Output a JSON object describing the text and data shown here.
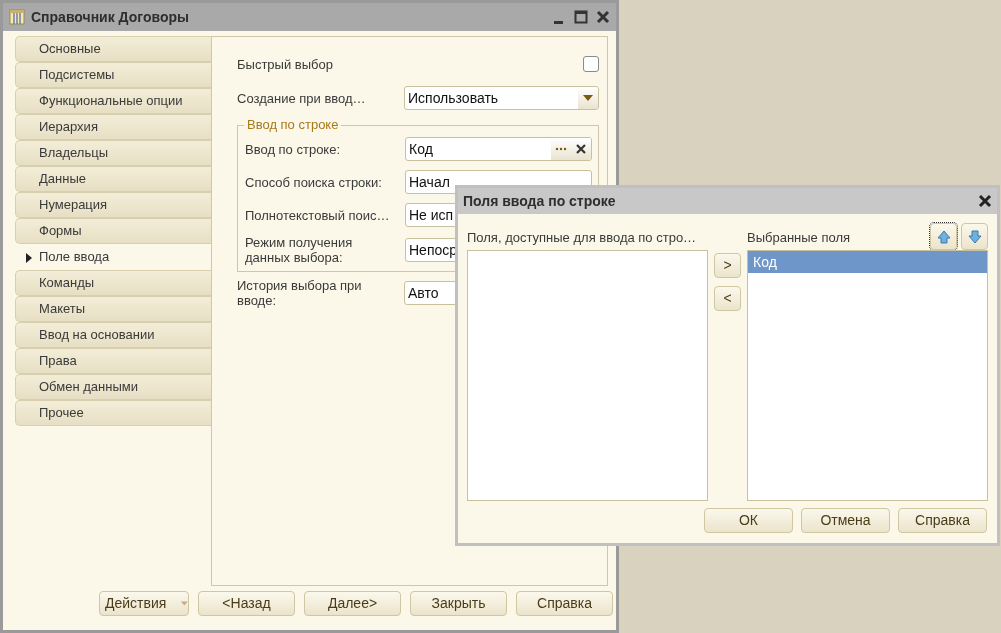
{
  "window": {
    "title": "Справочник Договоры"
  },
  "sections": [
    {
      "label": "Основные",
      "selected": false
    },
    {
      "label": "Подсистемы",
      "selected": false
    },
    {
      "label": "Функциональные опции",
      "selected": false
    },
    {
      "label": "Иерархия",
      "selected": false
    },
    {
      "label": "Владельцы",
      "selected": false
    },
    {
      "label": "Данные",
      "selected": false
    },
    {
      "label": "Нумерация",
      "selected": false
    },
    {
      "label": "Формы",
      "selected": false
    },
    {
      "label": "Поле ввода",
      "selected": true
    },
    {
      "label": "Команды",
      "selected": false
    },
    {
      "label": "Макеты",
      "selected": false
    },
    {
      "label": "Ввод на основании",
      "selected": false
    },
    {
      "label": "Права",
      "selected": false
    },
    {
      "label": "Обмен данными",
      "selected": false
    },
    {
      "label": "Прочее",
      "selected": false
    }
  ],
  "form": {
    "quick_select": {
      "label": "Быстрый выбор",
      "checked": false
    },
    "create_on_input": {
      "label": "Создание при ввод…",
      "value": "Использовать"
    },
    "group": {
      "title": "Ввод по строке",
      "fields": [
        {
          "kind": "select",
          "label": "Ввод по строке:",
          "value": "Код"
        },
        {
          "kind": "plain",
          "label": "Способ поиска строки:",
          "value": "Начал"
        },
        {
          "kind": "plain",
          "label": "Полнотекстовый поис…",
          "value": "Не исп"
        },
        {
          "kind": "plain",
          "label": "Режим получения данных выбора:",
          "value": "Непоср"
        }
      ]
    },
    "history": {
      "label": "История выбора при вводе:",
      "value": "Авто"
    }
  },
  "buttons": [
    {
      "label": "Действия",
      "kind": "menu"
    },
    {
      "label": "<Назад",
      "kind": "plain"
    },
    {
      "label": "Далее>",
      "kind": "plain"
    },
    {
      "label": "Закрыть",
      "kind": "plain"
    },
    {
      "label": "Справка",
      "kind": "plain"
    }
  ],
  "dialog": {
    "title": "Поля ввода по строке",
    "available": {
      "label": "Поля, доступные для ввода по стро…"
    },
    "move_buttons": [
      ">",
      "<"
    ],
    "chosen": {
      "label": "Выбранные поля",
      "items": [
        {
          "label": "Код",
          "selected": true
        }
      ]
    },
    "buttons": [
      "ОК",
      "Отмена",
      "Справка"
    ]
  }
}
